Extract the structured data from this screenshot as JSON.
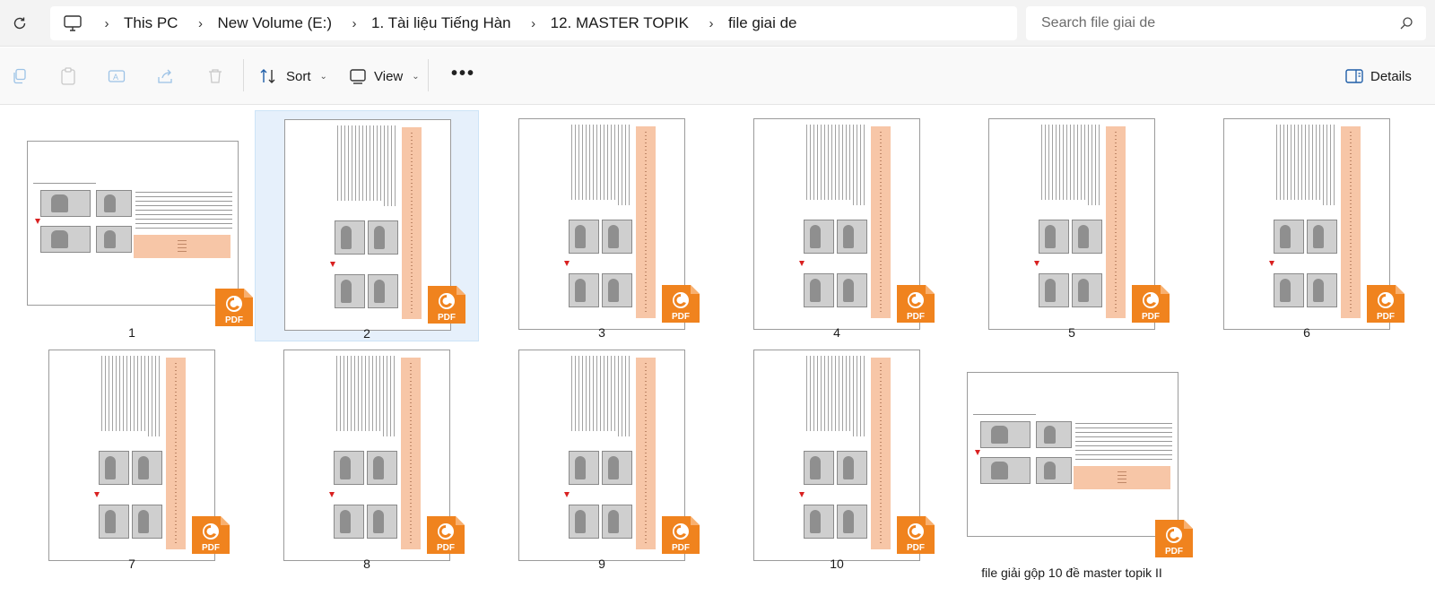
{
  "address_bar": {
    "breadcrumbs": [
      "This PC",
      "New Volume (E:)",
      "1. Tài liệu Tiếng Hàn",
      "12. MASTER TOPIK",
      "file giai de"
    ],
    "search_placeholder": "Search file giai de"
  },
  "toolbar": {
    "sort_label": "Sort",
    "view_label": "View",
    "more_label": "•••",
    "details_label": "Details"
  },
  "files": [
    {
      "name": "1",
      "orientation": "landscape",
      "selected": false
    },
    {
      "name": "2",
      "orientation": "portrait",
      "selected": true
    },
    {
      "name": "3",
      "orientation": "portrait",
      "selected": false
    },
    {
      "name": "4",
      "orientation": "portrait",
      "selected": false
    },
    {
      "name": "5",
      "orientation": "portrait",
      "selected": false
    },
    {
      "name": "6",
      "orientation": "portrait",
      "selected": false
    },
    {
      "name": "7",
      "orientation": "portrait",
      "selected": false
    },
    {
      "name": "8",
      "orientation": "portrait",
      "selected": false
    },
    {
      "name": "9",
      "orientation": "portrait",
      "selected": false
    },
    {
      "name": "10",
      "orientation": "portrait",
      "selected": false
    },
    {
      "name": "file giải gộp 10 đề master topik II",
      "orientation": "landscape",
      "selected": false
    }
  ],
  "file_type_badge": "PDF",
  "colors": {
    "accent_orange": "#f0831e",
    "selection_bg": "#e6f0fb",
    "answer_highlight": "#f7c6a7"
  }
}
